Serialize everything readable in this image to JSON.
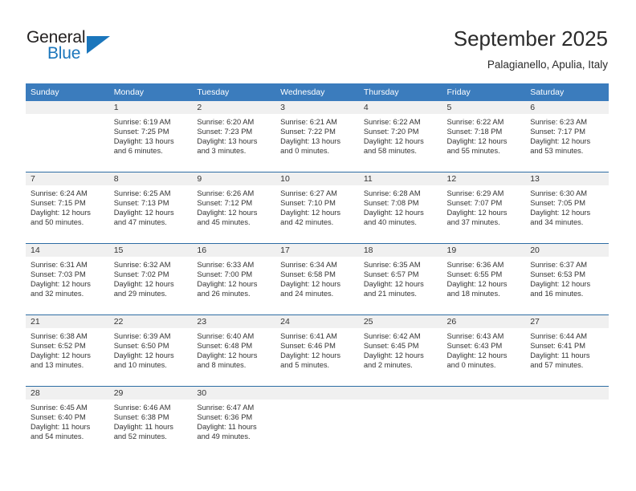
{
  "brand": {
    "name_top": "General",
    "name_bottom": "Blue",
    "accent_color": "#1b76bc"
  },
  "header": {
    "title": "September 2025",
    "location": "Palagianello, Apulia, Italy"
  },
  "theme": {
    "header_blue": "#3b7cbd",
    "grid_line": "#2e6da4",
    "daynum_band": "#f0f0f0",
    "text": "#333333"
  },
  "weekday_headers": [
    "Sunday",
    "Monday",
    "Tuesday",
    "Wednesday",
    "Thursday",
    "Friday",
    "Saturday"
  ],
  "weeks": [
    [
      {
        "day": "",
        "empty": true,
        "sunrise": "",
        "sunset": "",
        "daylight_1": "",
        "daylight_2": ""
      },
      {
        "day": "1",
        "sunrise": "Sunrise: 6:19 AM",
        "sunset": "Sunset: 7:25 PM",
        "daylight_1": "Daylight: 13 hours",
        "daylight_2": "and 6 minutes."
      },
      {
        "day": "2",
        "sunrise": "Sunrise: 6:20 AM",
        "sunset": "Sunset: 7:23 PM",
        "daylight_1": "Daylight: 13 hours",
        "daylight_2": "and 3 minutes."
      },
      {
        "day": "3",
        "sunrise": "Sunrise: 6:21 AM",
        "sunset": "Sunset: 7:22 PM",
        "daylight_1": "Daylight: 13 hours",
        "daylight_2": "and 0 minutes."
      },
      {
        "day": "4",
        "sunrise": "Sunrise: 6:22 AM",
        "sunset": "Sunset: 7:20 PM",
        "daylight_1": "Daylight: 12 hours",
        "daylight_2": "and 58 minutes."
      },
      {
        "day": "5",
        "sunrise": "Sunrise: 6:22 AM",
        "sunset": "Sunset: 7:18 PM",
        "daylight_1": "Daylight: 12 hours",
        "daylight_2": "and 55 minutes."
      },
      {
        "day": "6",
        "sunrise": "Sunrise: 6:23 AM",
        "sunset": "Sunset: 7:17 PM",
        "daylight_1": "Daylight: 12 hours",
        "daylight_2": "and 53 minutes."
      }
    ],
    [
      {
        "day": "7",
        "sunrise": "Sunrise: 6:24 AM",
        "sunset": "Sunset: 7:15 PM",
        "daylight_1": "Daylight: 12 hours",
        "daylight_2": "and 50 minutes."
      },
      {
        "day": "8",
        "sunrise": "Sunrise: 6:25 AM",
        "sunset": "Sunset: 7:13 PM",
        "daylight_1": "Daylight: 12 hours",
        "daylight_2": "and 47 minutes."
      },
      {
        "day": "9",
        "sunrise": "Sunrise: 6:26 AM",
        "sunset": "Sunset: 7:12 PM",
        "daylight_1": "Daylight: 12 hours",
        "daylight_2": "and 45 minutes."
      },
      {
        "day": "10",
        "sunrise": "Sunrise: 6:27 AM",
        "sunset": "Sunset: 7:10 PM",
        "daylight_1": "Daylight: 12 hours",
        "daylight_2": "and 42 minutes."
      },
      {
        "day": "11",
        "sunrise": "Sunrise: 6:28 AM",
        "sunset": "Sunset: 7:08 PM",
        "daylight_1": "Daylight: 12 hours",
        "daylight_2": "and 40 minutes."
      },
      {
        "day": "12",
        "sunrise": "Sunrise: 6:29 AM",
        "sunset": "Sunset: 7:07 PM",
        "daylight_1": "Daylight: 12 hours",
        "daylight_2": "and 37 minutes."
      },
      {
        "day": "13",
        "sunrise": "Sunrise: 6:30 AM",
        "sunset": "Sunset: 7:05 PM",
        "daylight_1": "Daylight: 12 hours",
        "daylight_2": "and 34 minutes."
      }
    ],
    [
      {
        "day": "14",
        "sunrise": "Sunrise: 6:31 AM",
        "sunset": "Sunset: 7:03 PM",
        "daylight_1": "Daylight: 12 hours",
        "daylight_2": "and 32 minutes."
      },
      {
        "day": "15",
        "sunrise": "Sunrise: 6:32 AM",
        "sunset": "Sunset: 7:02 PM",
        "daylight_1": "Daylight: 12 hours",
        "daylight_2": "and 29 minutes."
      },
      {
        "day": "16",
        "sunrise": "Sunrise: 6:33 AM",
        "sunset": "Sunset: 7:00 PM",
        "daylight_1": "Daylight: 12 hours",
        "daylight_2": "and 26 minutes."
      },
      {
        "day": "17",
        "sunrise": "Sunrise: 6:34 AM",
        "sunset": "Sunset: 6:58 PM",
        "daylight_1": "Daylight: 12 hours",
        "daylight_2": "and 24 minutes."
      },
      {
        "day": "18",
        "sunrise": "Sunrise: 6:35 AM",
        "sunset": "Sunset: 6:57 PM",
        "daylight_1": "Daylight: 12 hours",
        "daylight_2": "and 21 minutes."
      },
      {
        "day": "19",
        "sunrise": "Sunrise: 6:36 AM",
        "sunset": "Sunset: 6:55 PM",
        "daylight_1": "Daylight: 12 hours",
        "daylight_2": "and 18 minutes."
      },
      {
        "day": "20",
        "sunrise": "Sunrise: 6:37 AM",
        "sunset": "Sunset: 6:53 PM",
        "daylight_1": "Daylight: 12 hours",
        "daylight_2": "and 16 minutes."
      }
    ],
    [
      {
        "day": "21",
        "sunrise": "Sunrise: 6:38 AM",
        "sunset": "Sunset: 6:52 PM",
        "daylight_1": "Daylight: 12 hours",
        "daylight_2": "and 13 minutes."
      },
      {
        "day": "22",
        "sunrise": "Sunrise: 6:39 AM",
        "sunset": "Sunset: 6:50 PM",
        "daylight_1": "Daylight: 12 hours",
        "daylight_2": "and 10 minutes."
      },
      {
        "day": "23",
        "sunrise": "Sunrise: 6:40 AM",
        "sunset": "Sunset: 6:48 PM",
        "daylight_1": "Daylight: 12 hours",
        "daylight_2": "and 8 minutes."
      },
      {
        "day": "24",
        "sunrise": "Sunrise: 6:41 AM",
        "sunset": "Sunset: 6:46 PM",
        "daylight_1": "Daylight: 12 hours",
        "daylight_2": "and 5 minutes."
      },
      {
        "day": "25",
        "sunrise": "Sunrise: 6:42 AM",
        "sunset": "Sunset: 6:45 PM",
        "daylight_1": "Daylight: 12 hours",
        "daylight_2": "and 2 minutes."
      },
      {
        "day": "26",
        "sunrise": "Sunrise: 6:43 AM",
        "sunset": "Sunset: 6:43 PM",
        "daylight_1": "Daylight: 12 hours",
        "daylight_2": "and 0 minutes."
      },
      {
        "day": "27",
        "sunrise": "Sunrise: 6:44 AM",
        "sunset": "Sunset: 6:41 PM",
        "daylight_1": "Daylight: 11 hours",
        "daylight_2": "and 57 minutes."
      }
    ],
    [
      {
        "day": "28",
        "sunrise": "Sunrise: 6:45 AM",
        "sunset": "Sunset: 6:40 PM",
        "daylight_1": "Daylight: 11 hours",
        "daylight_2": "and 54 minutes."
      },
      {
        "day": "29",
        "sunrise": "Sunrise: 6:46 AM",
        "sunset": "Sunset: 6:38 PM",
        "daylight_1": "Daylight: 11 hours",
        "daylight_2": "and 52 minutes."
      },
      {
        "day": "30",
        "sunrise": "Sunrise: 6:47 AM",
        "sunset": "Sunset: 6:36 PM",
        "daylight_1": "Daylight: 11 hours",
        "daylight_2": "and 49 minutes."
      },
      {
        "day": "",
        "empty": true,
        "sunrise": "",
        "sunset": "",
        "daylight_1": "",
        "daylight_2": ""
      },
      {
        "day": "",
        "empty": true,
        "sunrise": "",
        "sunset": "",
        "daylight_1": "",
        "daylight_2": ""
      },
      {
        "day": "",
        "empty": true,
        "sunrise": "",
        "sunset": "",
        "daylight_1": "",
        "daylight_2": ""
      },
      {
        "day": "",
        "empty": true,
        "sunrise": "",
        "sunset": "",
        "daylight_1": "",
        "daylight_2": ""
      }
    ]
  ]
}
